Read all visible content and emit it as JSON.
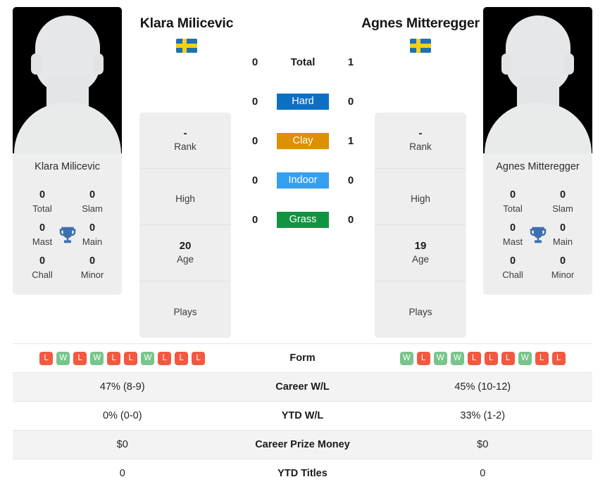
{
  "players": {
    "left": {
      "name": "Klara Milicevic",
      "card_name": "Klara Milicevic",
      "country": "Sweden",
      "flag_icon": "sweden-flag-icon",
      "avatar_icon": "player-avatar-placeholder-icon",
      "titles": {
        "total_value": "0",
        "total_label": "Total",
        "slam_value": "0",
        "slam_label": "Slam",
        "mast_value": "0",
        "mast_label": "Mast",
        "main_value": "0",
        "main_label": "Main",
        "chall_value": "0",
        "chall_label": "Chall",
        "minor_value": "0",
        "minor_label": "Minor",
        "trophy_icon": "trophy-icon"
      },
      "info": [
        {
          "value": "-",
          "label": "Rank"
        },
        {
          "value": "",
          "label": "High"
        },
        {
          "value": "20",
          "label": "Age"
        },
        {
          "value": "",
          "label": "Plays"
        }
      ]
    },
    "right": {
      "name": "Agnes Mitteregger",
      "card_name": "Agnes Mitteregger",
      "country": "Sweden",
      "flag_icon": "sweden-flag-icon",
      "avatar_icon": "player-avatar-placeholder-icon",
      "titles": {
        "total_value": "0",
        "total_label": "Total",
        "slam_value": "0",
        "slam_label": "Slam",
        "mast_value": "0",
        "mast_label": "Mast",
        "main_value": "0",
        "main_label": "Main",
        "chall_value": "0",
        "chall_label": "Chall",
        "minor_value": "0",
        "minor_label": "Minor",
        "trophy_icon": "trophy-icon"
      },
      "info": [
        {
          "value": "-",
          "label": "Rank"
        },
        {
          "value": "",
          "label": "High"
        },
        {
          "value": "19",
          "label": "Age"
        },
        {
          "value": "",
          "label": "Plays"
        }
      ]
    }
  },
  "head_to_head": [
    {
      "label": "Total",
      "left": "0",
      "right": "1",
      "badge": false,
      "color": ""
    },
    {
      "label": "Hard",
      "left": "0",
      "right": "0",
      "badge": true,
      "color": "#0d6fc4"
    },
    {
      "label": "Clay",
      "left": "0",
      "right": "1",
      "badge": true,
      "color": "#dd9000"
    },
    {
      "label": "Indoor",
      "left": "0",
      "right": "0",
      "badge": true,
      "color": "#35a0f0"
    },
    {
      "label": "Grass",
      "left": "0",
      "right": "0",
      "badge": true,
      "color": "#119441"
    }
  ],
  "stats_rows": [
    {
      "label": "Form",
      "type": "form",
      "left_form": [
        "L",
        "W",
        "L",
        "W",
        "L",
        "L",
        "W",
        "L",
        "L",
        "L"
      ],
      "right_form": [
        "W",
        "L",
        "W",
        "W",
        "L",
        "L",
        "L",
        "W",
        "L",
        "L"
      ],
      "left": "",
      "right": "",
      "alt": false
    },
    {
      "label": "Career W/L",
      "type": "text",
      "left": "47% (8-9)",
      "right": "45% (10-12)",
      "alt": true
    },
    {
      "label": "YTD W/L",
      "type": "text",
      "left": "0% (0-0)",
      "right": "33% (1-2)",
      "alt": false
    },
    {
      "label": "Career Prize Money",
      "type": "text",
      "left": "$0",
      "right": "$0",
      "alt": true
    },
    {
      "label": "YTD Titles",
      "type": "text",
      "left": "0",
      "right": "0",
      "alt": false
    }
  ],
  "colors": {
    "win": "#78c48a",
    "loss": "#f2593f",
    "panel": "#eeeeee",
    "stripe": "#f3f3f3",
    "trophy": "#3d6fae"
  }
}
